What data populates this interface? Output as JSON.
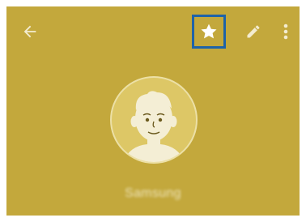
{
  "app": {
    "accent_color": "#c3a83c",
    "highlight_color": "#1e63a8"
  },
  "toolbar": {
    "back_icon": "back-arrow-icon",
    "favorite_icon": "star-icon",
    "edit_icon": "pencil-icon",
    "more_icon": "more-vert-icon",
    "favorite_selected": true
  },
  "profile": {
    "avatar_icon": "person-avatar-icon",
    "name": "Samsung"
  }
}
